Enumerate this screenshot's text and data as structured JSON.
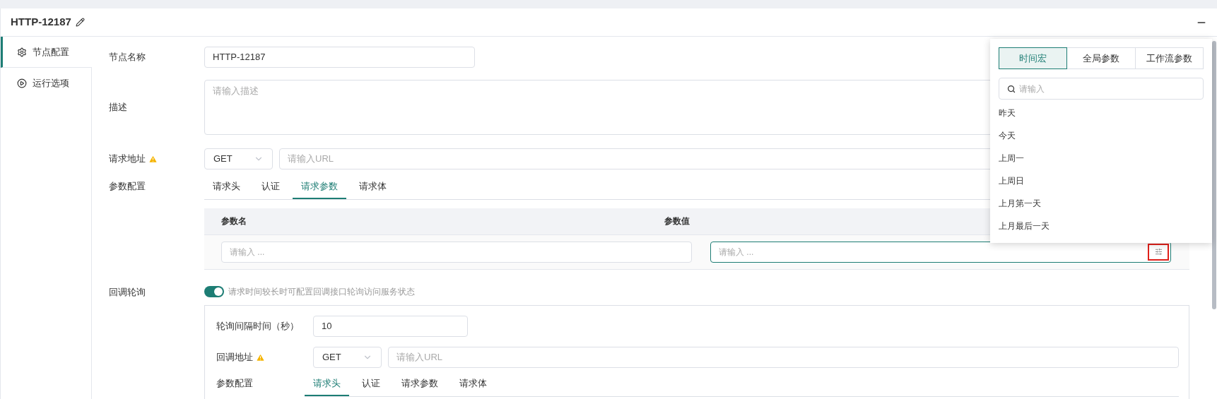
{
  "header": {
    "title": "HTTP-12187"
  },
  "sidebar": {
    "items": [
      {
        "label": "节点配置",
        "kind": "gear",
        "selected": true
      },
      {
        "label": "运行选项",
        "kind": "play",
        "selected": false
      }
    ]
  },
  "form": {
    "name": {
      "label": "节点名称",
      "value": "HTTP-12187"
    },
    "description": {
      "label": "描述",
      "placeholder": "请输入描述"
    },
    "request_url": {
      "label": "请求地址",
      "warning": true,
      "method": "GET",
      "placeholder": "请输入URL"
    },
    "params": {
      "label": "参数配置",
      "tabs": [
        {
          "label": "请求头",
          "selected": false
        },
        {
          "label": "认证",
          "selected": false
        },
        {
          "label": "请求参数",
          "selected": true
        },
        {
          "label": "请求体",
          "selected": false
        }
      ],
      "table": {
        "columns": [
          "参数名",
          "参数值"
        ],
        "rows": [
          {
            "name_placeholder": "请输入 ...",
            "value_placeholder": "请输入 ..."
          }
        ]
      }
    },
    "callback": {
      "label": "回调轮询",
      "on": true,
      "hint": "请求时间较长时可配置回调接口轮询访问服务状态",
      "interval": {
        "label": "轮询间隔时间（秒）",
        "value": "10"
      },
      "url": {
        "label": "回调地址",
        "warning": true,
        "method": "GET",
        "placeholder": "请输入URL"
      },
      "params": {
        "label": "参数配置",
        "tabs": [
          {
            "label": "请求头",
            "selected": true
          },
          {
            "label": "认证",
            "selected": false
          },
          {
            "label": "请求参数",
            "selected": false
          },
          {
            "label": "请求体",
            "selected": false
          }
        ]
      }
    }
  },
  "popover": {
    "tabs": [
      {
        "label": "时间宏",
        "selected": true
      },
      {
        "label": "全局参数",
        "selected": false
      },
      {
        "label": "工作流参数",
        "selected": false
      }
    ],
    "search": {
      "placeholder": "请输入"
    },
    "items": [
      "昨天",
      "今天",
      "上周一",
      "上周日",
      "上月第一天",
      "上月最后一天"
    ]
  }
}
